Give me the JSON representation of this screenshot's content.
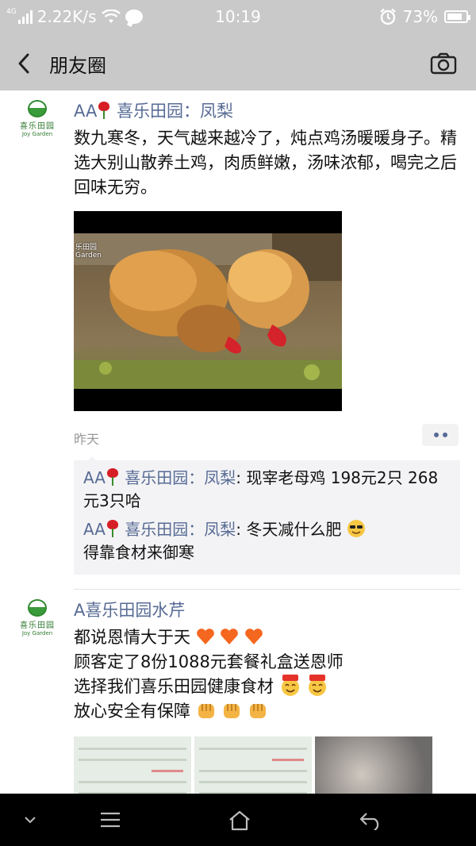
{
  "status_bar": {
    "network": "4G",
    "speed": "2.22K/s",
    "time": "10:19",
    "battery": "73%",
    "icons": [
      "signal-icon",
      "wifi-icon",
      "message-icon",
      "alarm-icon",
      "battery-icon"
    ]
  },
  "nav": {
    "title": "朋友圈",
    "back_icon": "back-arrow-icon",
    "camera_icon": "camera-icon"
  },
  "posts": [
    {
      "author": "AA🌹 喜乐田园：凤梨",
      "author_prefix": "AA",
      "author_name": " 喜乐田园：凤梨",
      "avatar_text_cn": "喜乐田园",
      "avatar_text_en": "Joy Garden",
      "text": "数九寒冬，天气越来越冷了，炖点鸡汤暖暖身子。精选大别山散养土鸡，肉质鲜嫩，汤味浓郁，喝完之后回味无穷。",
      "video_watermark": "乐田园",
      "video_watermark_en": "Garden",
      "time": "昨天",
      "comments": [
        {
          "who_prefix": "AA",
          "who_name": " 喜乐田园：凤梨",
          "text": ": 现宰老母鸡  198元2只  268元3只哈"
        },
        {
          "who_prefix": "AA",
          "who_name": " 喜乐田园：凤梨",
          "text": ": 冬天减什么肥 ",
          "text_tail": " 得靠食材来御寒"
        }
      ]
    },
    {
      "author": "A喜乐田园水芹",
      "avatar_text_cn": "喜乐田园",
      "avatar_text_en": "Joy Garden",
      "lines": [
        "都说恩情大于天",
        "顾客定了8份1088元套餐礼盒送恩师",
        "选择我们喜乐田园健康食材",
        "放心安全有保障"
      ]
    }
  ],
  "colors": {
    "bar_bg": "#c9c9c9",
    "link_blue": "#576b95",
    "comment_bg": "#f3f3f5"
  }
}
